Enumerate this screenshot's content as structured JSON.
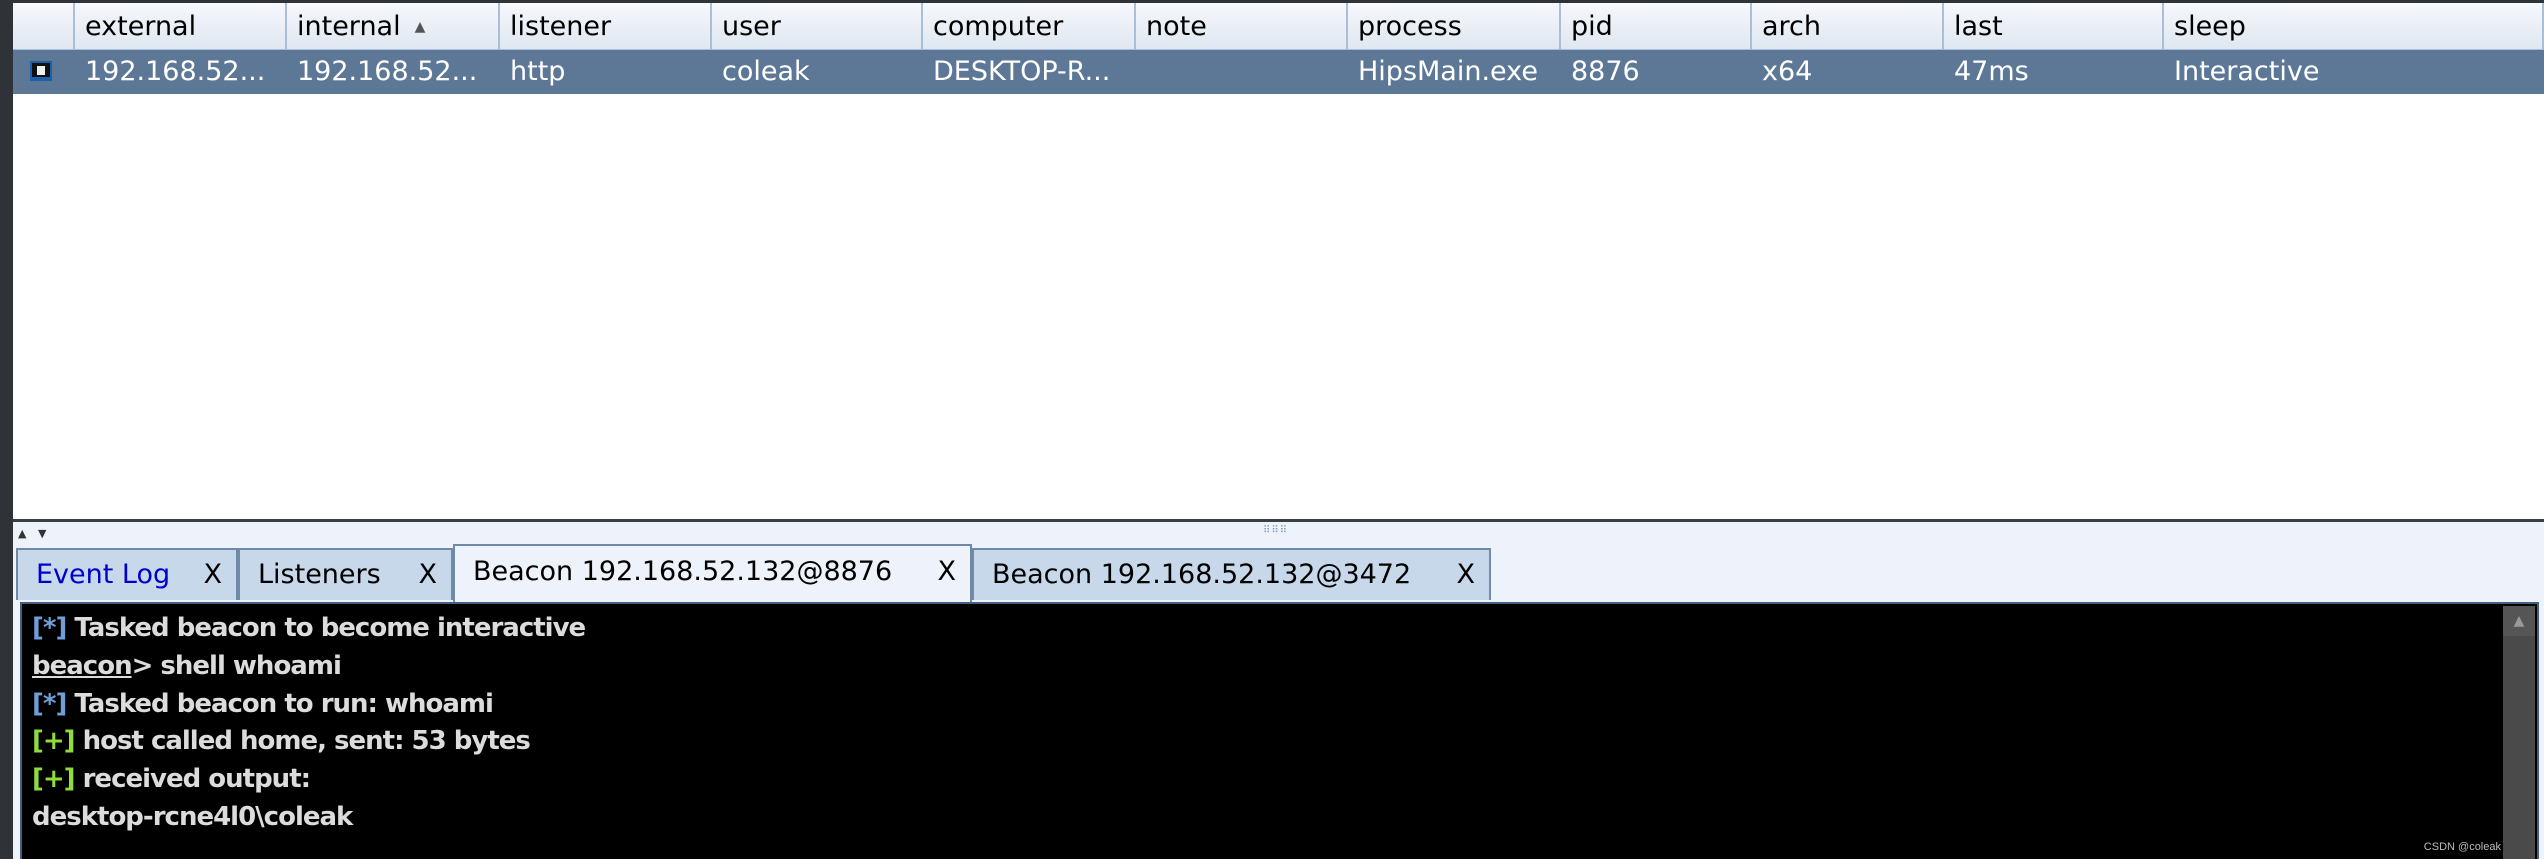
{
  "table": {
    "columns": [
      "external",
      "internal",
      "listener",
      "user",
      "computer",
      "note",
      "process",
      "pid",
      "arch",
      "last",
      "sleep"
    ],
    "sorted_column": "internal",
    "sort_direction": "ascending",
    "rows": [
      {
        "icon": "beacon-computer-icon",
        "external": "192.168.52...",
        "internal": "192.168.52...",
        "listener": "http",
        "user": "coleak",
        "computer": "DESKTOP-R...",
        "note": "",
        "process": "HipsMain.exe",
        "pid": "8876",
        "arch": "x64",
        "last": "47ms",
        "sleep": "Interactive",
        "selected": true
      }
    ]
  },
  "tabs": [
    {
      "label": "Event Log",
      "close": "X",
      "color": "#0000cc"
    },
    {
      "label": "Listeners",
      "close": "X"
    },
    {
      "label": "Beacon 192.168.52.132@8876",
      "close": "X",
      "active": true
    },
    {
      "label": "Beacon 192.168.52.132@3472",
      "close": "X"
    }
  ],
  "console": {
    "lines": [
      {
        "prefix": "[*]",
        "text": " Tasked beacon to become interactive"
      },
      {
        "prompt": "beacon",
        "text": "> shell whoami"
      },
      {
        "prefix": "[*]",
        "text": " Tasked beacon to run: whoami"
      },
      {
        "prefix": "[+]",
        "text": " host called home, sent: 53 bytes"
      },
      {
        "prefix": "[+]",
        "text": " received output:"
      },
      {
        "text": "desktop-rcne4l0\\coleak"
      }
    ]
  },
  "watermark": "CSDN @coleak",
  "colors": {
    "selected_row": "#5d7896",
    "info_prefix": "#6f9fd8",
    "success_prefix": "#8fdc3a",
    "console_bg": "#000000"
  }
}
